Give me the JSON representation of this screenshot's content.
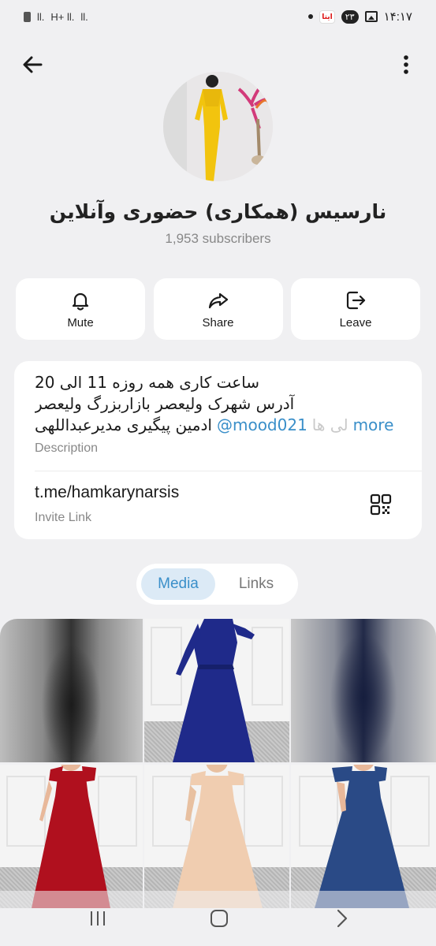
{
  "status_bar": {
    "time": "۱۴:۱۷",
    "badge_count": "۲۳",
    "app_badge": "ایتا",
    "signal_1": "ll.",
    "signal_2": "H+ ll.",
    "signal_3": "ll."
  },
  "header": {
    "back_icon": "arrow-left-icon",
    "menu_icon": "more-vertical-icon"
  },
  "channel": {
    "title": "نارسیس (همکاری) حضوری وآنلاین",
    "subscribers": "1,953 subscribers"
  },
  "actions": [
    {
      "label": "Mute",
      "icon": "bell-icon"
    },
    {
      "label": "Share",
      "icon": "share-icon"
    },
    {
      "label": "Leave",
      "icon": "leave-icon"
    }
  ],
  "info": {
    "description_line1": "ساعت کاری همه روزه 11 الی 20",
    "description_line2": "آدرس شهرک ولیعصر بازاربزرگ ولیعصر",
    "description_line3": "ادمین پیگیری  مدیرعبداللهی ",
    "description_mention": "@mood021",
    "description_faded": "لی ها",
    "description_more": "more",
    "description_label": "Description",
    "invite_link": "t.me/hamkarynarsis",
    "invite_label": "Invite Link"
  },
  "tabs": [
    {
      "label": "Media",
      "active": true
    },
    {
      "label": "Links",
      "active": false
    }
  ],
  "media": [
    {
      "kind": "blurred",
      "color": "#2a2a2a"
    },
    {
      "kind": "dress",
      "color": "#1f2a8a"
    },
    {
      "kind": "blurred",
      "color": "#1c2552"
    },
    {
      "kind": "dress",
      "color": "#b0101e"
    },
    {
      "kind": "dress",
      "color": "#f0cdb0"
    },
    {
      "kind": "dress",
      "color": "#2a4a86"
    }
  ],
  "colors": {
    "accent": "#3a8fc9",
    "background": "#f0f0f2",
    "card": "#ffffff"
  }
}
